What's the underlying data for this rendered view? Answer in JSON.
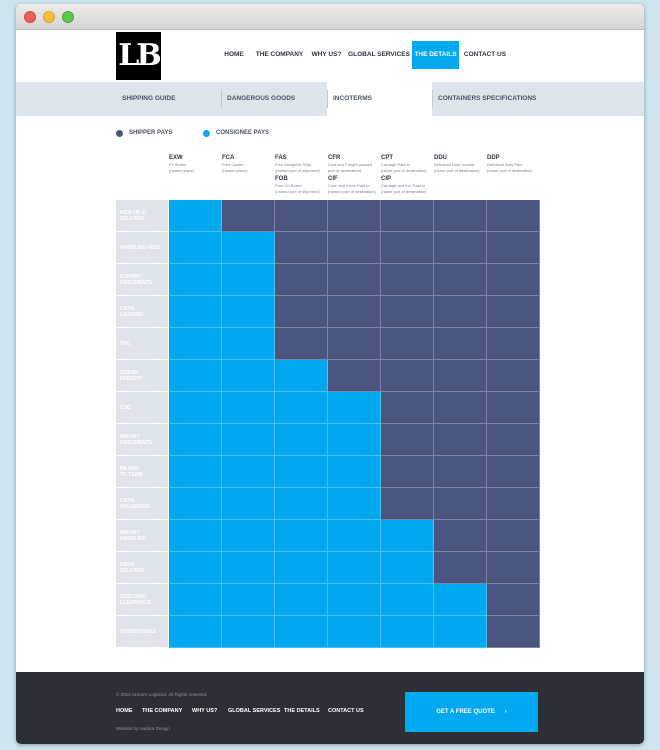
{
  "logo": "LB",
  "nav": {
    "items": [
      {
        "label": "HOME",
        "active": false
      },
      {
        "label": "THE COMPANY",
        "active": false
      },
      {
        "label": "WHY US?",
        "active": false
      },
      {
        "label": "GLOBAL SERVICES",
        "active": false
      },
      {
        "label": "THE DETAILS",
        "active": true
      },
      {
        "label": "CONTACT US",
        "active": false
      }
    ]
  },
  "subnav": {
    "items": [
      {
        "label": "SHIPPING GUIDE",
        "active": false
      },
      {
        "label": "DANGEROUS GOODS",
        "active": false
      },
      {
        "label": "INCOTERMS",
        "active": true
      },
      {
        "label": "CONTAINERS SPECIFICATIONS",
        "active": false
      }
    ]
  },
  "legend": {
    "shipper": "SHIPPER PAYS",
    "consignee": "CONSIGNEE PAYS"
  },
  "colors": {
    "shipper": "#4a5680",
    "consignee": "#00a8f0",
    "accent": "#00a8f0",
    "footer": "#2c2f36"
  },
  "terms": [
    {
      "code": "EXW",
      "desc": [
        "Ex Works...",
        "(named place)"
      ]
    },
    {
      "code": "FCA",
      "desc": [
        "Free Carrier...",
        "(named place)"
      ]
    },
    {
      "code": "FAS",
      "desc": [
        "Free Alongside Ship",
        "(named port of shipment)"
      ],
      "code2": "FOB",
      "desc2": [
        "Free On Board",
        "(named port of shipment)"
      ]
    },
    {
      "code": "CFR",
      "desc": [
        "Cost and Freight (named",
        "port of destination)"
      ],
      "code2": "CIF",
      "desc2": [
        "Cost, and Insur. Paid to",
        "(named port of destination)"
      ]
    },
    {
      "code": "CPT",
      "desc": [
        "Carriage Paid to",
        "(name port of destination)"
      ],
      "code2": "CIP",
      "desc2": [
        "Carriage and Ins. Paid to",
        "(name port of destination)"
      ]
    },
    {
      "code": "DDU",
      "desc": [
        "Delivered Duty Unpaid",
        "(name port of destination)"
      ]
    },
    {
      "code": "DDP",
      "desc": [
        "Delivered Duty Paid",
        "(name port of destination)"
      ]
    }
  ],
  "rows": [
    {
      "label": [
        "PICK UP &",
        "DELIVERY"
      ],
      "consignee_cols": 1
    },
    {
      "label": [
        "HANDLING FEES"
      ],
      "consignee_cols": 2
    },
    {
      "label": [
        "EXPORT",
        "DOCUMENTS"
      ],
      "consignee_cols": 2
    },
    {
      "label": [
        "CNTR.",
        "LOADING"
      ],
      "consignee_cols": 2
    },
    {
      "label": [
        "THC"
      ],
      "consignee_cols": 2
    },
    {
      "label": [
        "OCEAN",
        "FREIGHT"
      ],
      "consignee_cols": 3
    },
    {
      "label": [
        "CSC"
      ],
      "consignee_cols": 4
    },
    {
      "label": [
        "IMPORT",
        "DOCUMENTS"
      ],
      "consignee_cols": 4
    },
    {
      "label": [
        "INLAND",
        "TO TERM"
      ],
      "consignee_cols": 4
    },
    {
      "label": [
        "CNTR.",
        "UNLOADING"
      ],
      "consignee_cols": 4
    },
    {
      "label": [
        "IMPORT",
        "HANDLING"
      ],
      "consignee_cols": 5
    },
    {
      "label": [
        "DOOR",
        "DELIVERY"
      ],
      "consignee_cols": 5
    },
    {
      "label": [
        "CUSTOMS",
        "CLEARANCE"
      ],
      "consignee_cols": 6
    },
    {
      "label": [
        "DUTIES/TAXES"
      ],
      "consignee_cols": 6
    }
  ],
  "footer": {
    "copyright": "© 2013 Unicorn Logistics. All Rights reserved.",
    "nav": [
      "HOME",
      "THE COMPANY",
      "WHY US?",
      "GLOBAL SERVICES",
      "THE DETAILS",
      "CONTACT US"
    ],
    "credit": "Website by Isadora Design",
    "cta": "GET A FREE QUOTE",
    "cta_icon": "chevron-right-icon"
  }
}
